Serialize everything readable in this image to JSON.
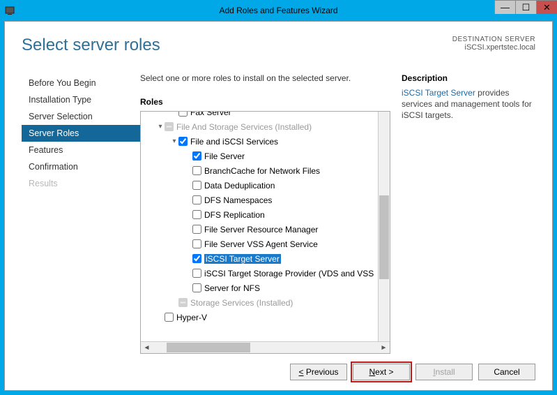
{
  "window": {
    "title": "Add Roles and Features Wizard"
  },
  "page_heading": "Select server roles",
  "destination": {
    "label": "DESTINATION SERVER",
    "value": "iSCSI.xpertstec.local"
  },
  "nav": {
    "items": [
      {
        "label": "Before You Begin"
      },
      {
        "label": "Installation Type"
      },
      {
        "label": "Server Selection"
      },
      {
        "label": "Server Roles",
        "active": true
      },
      {
        "label": "Features"
      },
      {
        "label": "Confirmation"
      },
      {
        "label": "Results",
        "disabled": true
      }
    ]
  },
  "instruction": "Select one or more roles to install on the selected server.",
  "roles_label": "Roles",
  "tree": [
    {
      "depth": 1,
      "checkbox": false,
      "label": "Fax Server",
      "partial_cut": true
    },
    {
      "depth": 0,
      "expander": "▾",
      "checkbox": "indeterminate",
      "label": "File And Storage Services (Installed)",
      "muted": true
    },
    {
      "depth": 1,
      "expander": "▾",
      "checkbox": true,
      "label": "File and iSCSI Services"
    },
    {
      "depth": 2,
      "checkbox": true,
      "label": "File Server"
    },
    {
      "depth": 2,
      "checkbox": false,
      "label": "BranchCache for Network Files"
    },
    {
      "depth": 2,
      "checkbox": false,
      "label": "Data Deduplication"
    },
    {
      "depth": 2,
      "checkbox": false,
      "label": "DFS Namespaces"
    },
    {
      "depth": 2,
      "checkbox": false,
      "label": "DFS Replication"
    },
    {
      "depth": 2,
      "checkbox": false,
      "label": "File Server Resource Manager"
    },
    {
      "depth": 2,
      "checkbox": false,
      "label": "File Server VSS Agent Service"
    },
    {
      "depth": 2,
      "checkbox": true,
      "label": "iSCSI Target Server",
      "selected": true
    },
    {
      "depth": 2,
      "checkbox": false,
      "label": "iSCSI Target Storage Provider (VDS and VSS"
    },
    {
      "depth": 2,
      "checkbox": false,
      "label": "Server for NFS"
    },
    {
      "depth": 1,
      "checkbox": "indeterminate",
      "label": "Storage Services (Installed)",
      "muted": true
    },
    {
      "depth": 0,
      "checkbox": false,
      "label": "Hyper-V"
    }
  ],
  "description": {
    "label": "Description",
    "link_text": "iSCSI Target Server",
    "rest_text": " provides services and management tools for iSCSI targets."
  },
  "buttons": {
    "previous": "< Previous",
    "next": "Next >",
    "install": "Install",
    "cancel": "Cancel"
  }
}
